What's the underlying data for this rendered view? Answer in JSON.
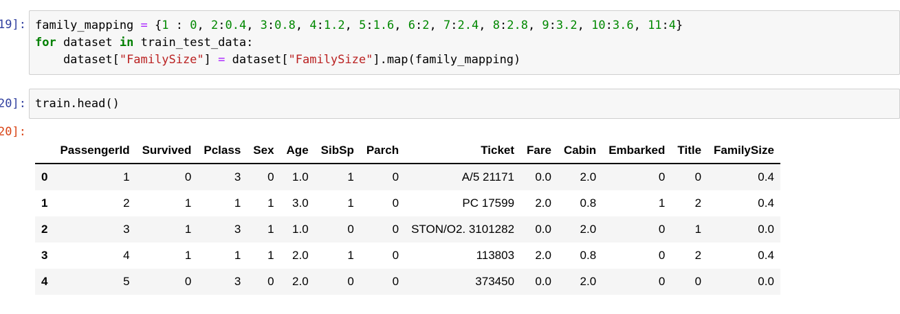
{
  "cells": [
    {
      "prompt": "[19]:",
      "code_lines": [
        [
          {
            "t": "family_mapping ",
            "c": ""
          },
          {
            "t": "=",
            "c": "op"
          },
          {
            "t": " {",
            "c": ""
          },
          {
            "t": "1",
            "c": "num"
          },
          {
            "t": " : ",
            "c": ""
          },
          {
            "t": "0",
            "c": "num"
          },
          {
            "t": ", ",
            "c": ""
          },
          {
            "t": "2",
            "c": "num"
          },
          {
            "t": ":",
            "c": ""
          },
          {
            "t": "0.4",
            "c": "num"
          },
          {
            "t": ", ",
            "c": ""
          },
          {
            "t": "3",
            "c": "num"
          },
          {
            "t": ":",
            "c": ""
          },
          {
            "t": "0.8",
            "c": "num"
          },
          {
            "t": ", ",
            "c": ""
          },
          {
            "t": "4",
            "c": "num"
          },
          {
            "t": ":",
            "c": ""
          },
          {
            "t": "1.2",
            "c": "num"
          },
          {
            "t": ", ",
            "c": ""
          },
          {
            "t": "5",
            "c": "num"
          },
          {
            "t": ":",
            "c": ""
          },
          {
            "t": "1.6",
            "c": "num"
          },
          {
            "t": ", ",
            "c": ""
          },
          {
            "t": "6",
            "c": "num"
          },
          {
            "t": ":",
            "c": ""
          },
          {
            "t": "2",
            "c": "num"
          },
          {
            "t": ", ",
            "c": ""
          },
          {
            "t": "7",
            "c": "num"
          },
          {
            "t": ":",
            "c": ""
          },
          {
            "t": "2.4",
            "c": "num"
          },
          {
            "t": ", ",
            "c": ""
          },
          {
            "t": "8",
            "c": "num"
          },
          {
            "t": ":",
            "c": ""
          },
          {
            "t": "2.8",
            "c": "num"
          },
          {
            "t": ", ",
            "c": ""
          },
          {
            "t": "9",
            "c": "num"
          },
          {
            "t": ":",
            "c": ""
          },
          {
            "t": "3.2",
            "c": "num"
          },
          {
            "t": ", ",
            "c": ""
          },
          {
            "t": "10",
            "c": "num"
          },
          {
            "t": ":",
            "c": ""
          },
          {
            "t": "3.6",
            "c": "num"
          },
          {
            "t": ", ",
            "c": ""
          },
          {
            "t": "11",
            "c": "num"
          },
          {
            "t": ":",
            "c": ""
          },
          {
            "t": "4",
            "c": "num"
          },
          {
            "t": "}",
            "c": ""
          }
        ],
        [
          {
            "t": "for",
            "c": "kw"
          },
          {
            "t": " dataset ",
            "c": ""
          },
          {
            "t": "in",
            "c": "kw"
          },
          {
            "t": " train_test_data:",
            "c": ""
          }
        ],
        [
          {
            "t": "    dataset[",
            "c": ""
          },
          {
            "t": "\"FamilySize\"",
            "c": "str"
          },
          {
            "t": "] ",
            "c": ""
          },
          {
            "t": "=",
            "c": "op"
          },
          {
            "t": " dataset[",
            "c": ""
          },
          {
            "t": "\"FamilySize\"",
            "c": "str"
          },
          {
            "t": "].map(family_mapping)",
            "c": ""
          }
        ]
      ]
    },
    {
      "prompt": "[20]:",
      "code_lines": [
        [
          {
            "t": "train.head()",
            "c": ""
          }
        ]
      ]
    }
  ],
  "output": {
    "prompt": "[20]:",
    "columns": [
      "",
      "PassengerId",
      "Survived",
      "Pclass",
      "Sex",
      "Age",
      "SibSp",
      "Parch",
      "Ticket",
      "Fare",
      "Cabin",
      "Embarked",
      "Title",
      "FamilySize"
    ],
    "rows": [
      [
        "0",
        "1",
        "0",
        "3",
        "0",
        "1.0",
        "1",
        "0",
        "A/5 21171",
        "0.0",
        "2.0",
        "0",
        "0",
        "0.4"
      ],
      [
        "1",
        "2",
        "1",
        "1",
        "1",
        "3.0",
        "1",
        "0",
        "PC 17599",
        "2.0",
        "0.8",
        "1",
        "2",
        "0.4"
      ],
      [
        "2",
        "3",
        "1",
        "3",
        "1",
        "1.0",
        "0",
        "0",
        "STON/O2. 3101282",
        "0.0",
        "2.0",
        "0",
        "1",
        "0.0"
      ],
      [
        "3",
        "4",
        "1",
        "1",
        "1",
        "2.0",
        "1",
        "0",
        "113803",
        "2.0",
        "0.8",
        "0",
        "2",
        "0.4"
      ],
      [
        "4",
        "5",
        "0",
        "3",
        "0",
        "2.0",
        "0",
        "0",
        "373450",
        "0.0",
        "2.0",
        "0",
        "0",
        "0.0"
      ]
    ]
  },
  "colors": {
    "prompt_in": "#303f9f",
    "prompt_out": "#d84315",
    "keyword": "#008000",
    "number": "#008800",
    "string": "#ba2121",
    "operator": "#aa22ff"
  }
}
